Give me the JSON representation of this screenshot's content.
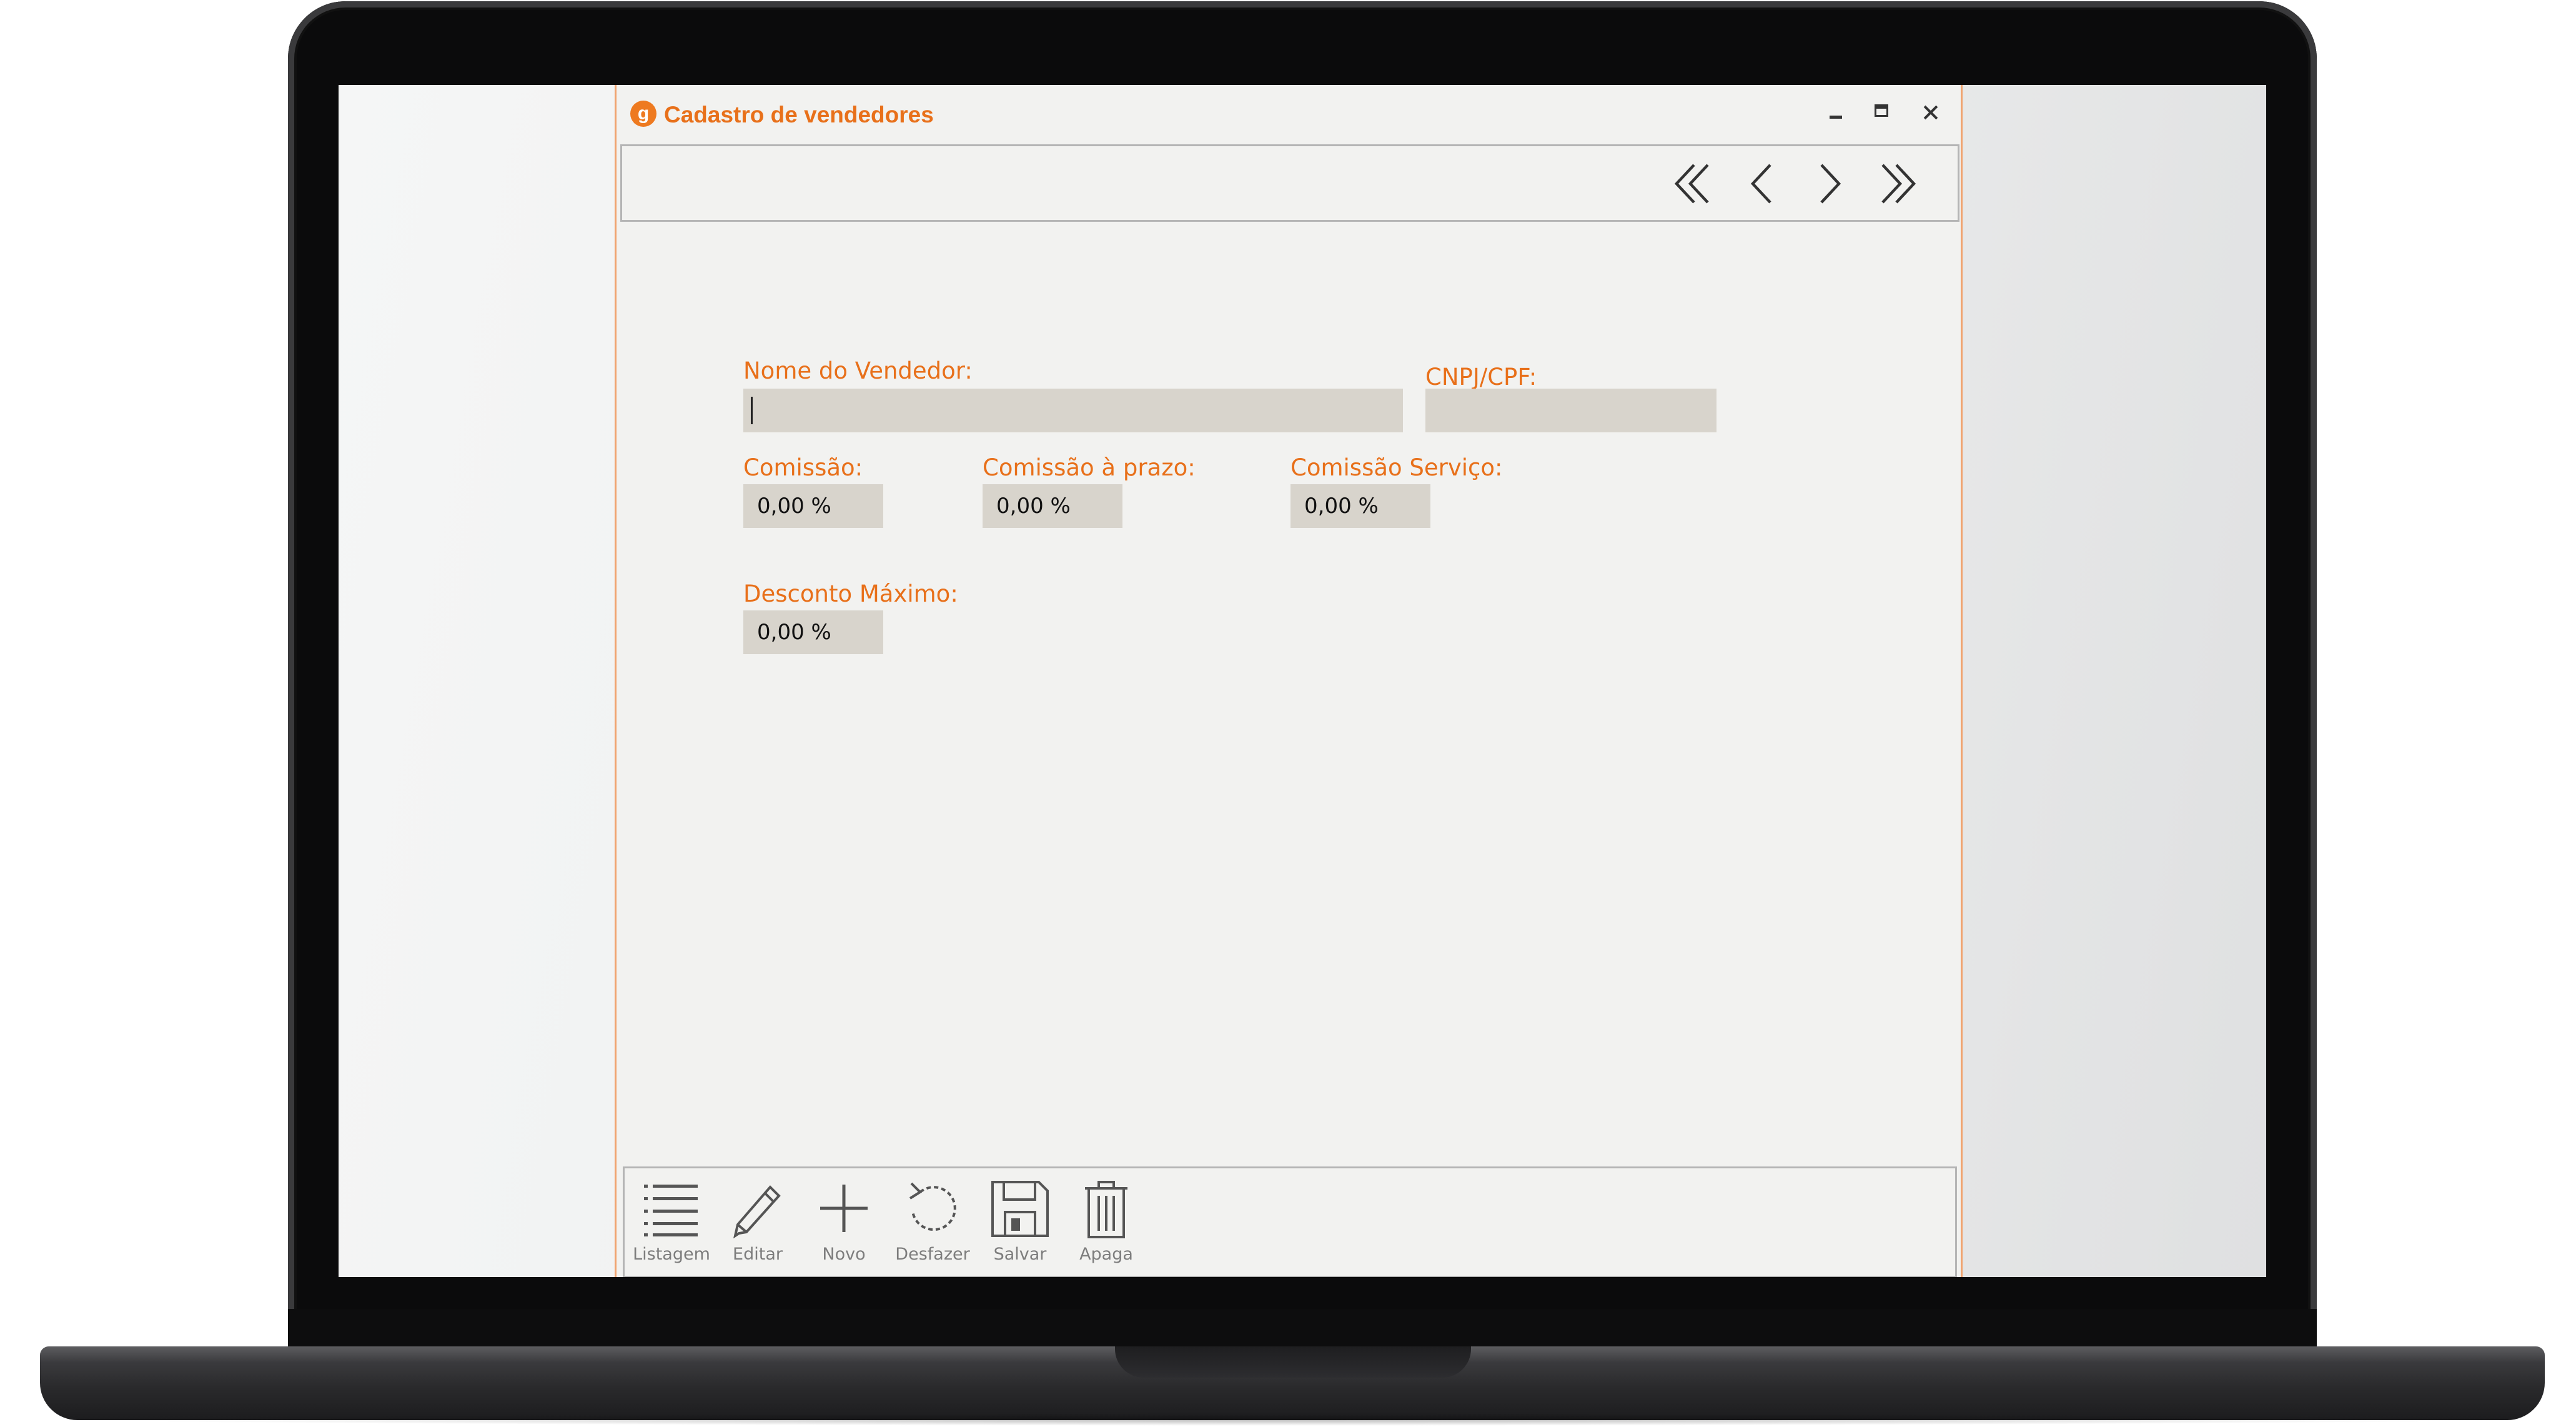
{
  "window": {
    "title": "Cadastro de vendedores",
    "app_icon_glyph": "g",
    "accent_color": "#e8701a",
    "controls": [
      "minimize-icon",
      "maximize-icon",
      "close-icon"
    ]
  },
  "navigation": {
    "buttons": [
      {
        "name": "first-record",
        "icon": "double-chevron-left-icon"
      },
      {
        "name": "previous-record",
        "icon": "chevron-left-icon"
      },
      {
        "name": "next-record",
        "icon": "chevron-right-icon"
      },
      {
        "name": "last-record",
        "icon": "double-chevron-right-icon"
      }
    ]
  },
  "form": {
    "nome_label": "Nome do Vendedor:",
    "nome_value": "",
    "cnpj_label": "CNPJ/CPF:",
    "cnpj_value": "",
    "comissao_label": "Comissão:",
    "comissao_value": "0,00 %",
    "comissao_prazo_label": "Comissão à prazo:",
    "comissao_prazo_value": "0,00 %",
    "comissao_servico_label": "Comissão Serviço:",
    "comissao_servico_value": "0,00 %",
    "desconto_label": "Desconto Máximo:",
    "desconto_value": "0,00 %"
  },
  "toolbar": {
    "listagem": "Listagem",
    "editar": "Editar",
    "novo": "Novo",
    "desfazer": "Desfazer",
    "salvar": "Salvar",
    "apaga": "Apaga",
    "icons": [
      "list-icon",
      "pencil-icon",
      "plus-icon",
      "undo-icon",
      "floppy-disk-icon",
      "trash-icon"
    ]
  }
}
